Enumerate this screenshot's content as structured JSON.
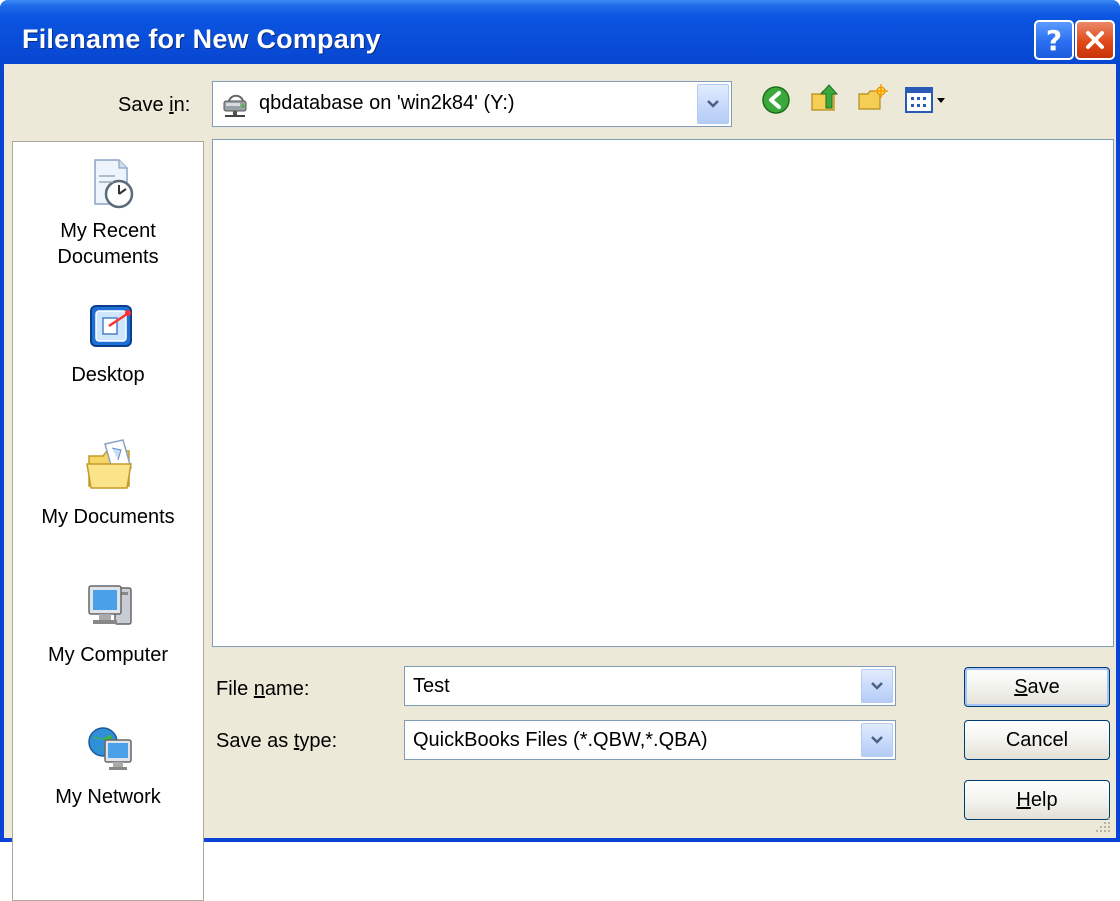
{
  "dialog": {
    "title": "Filename for New Company"
  },
  "save_in": {
    "label": "Save in:",
    "value": "qbdatabase on 'win2k84' (Y:)"
  },
  "toolbar": {
    "back_icon": "back-arrow-icon",
    "up_icon": "up-folder-icon",
    "new_folder_icon": "new-folder-icon",
    "views_icon": "views-menu-icon"
  },
  "places": [
    {
      "label": "My Recent Documents",
      "label_lines": [
        "My Recent",
        "Documents"
      ],
      "icon": "recent-documents-icon"
    },
    {
      "label": "Desktop",
      "icon": "desktop-icon"
    },
    {
      "label": "My Documents",
      "icon": "my-documents-icon"
    },
    {
      "label": "My Computer",
      "icon": "my-computer-icon"
    },
    {
      "label": "My Network",
      "icon": "my-network-icon"
    }
  ],
  "file_name": {
    "label": "File name:",
    "value": "Test"
  },
  "save_as_type": {
    "label": "Save as type:",
    "value": "QuickBooks Files (*.QBW,*.QBA)"
  },
  "buttons": {
    "save": "Save",
    "cancel": "Cancel",
    "help": "Help"
  }
}
